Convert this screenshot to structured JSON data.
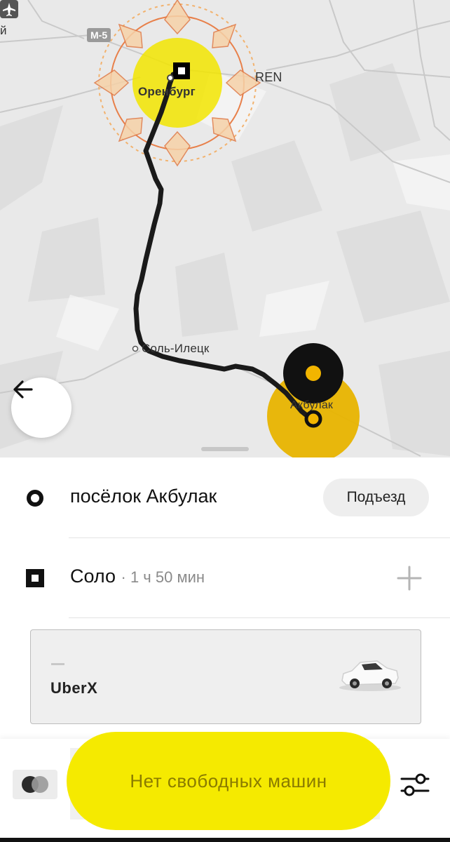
{
  "map": {
    "road_badge": "M-5",
    "edge_label": "й",
    "airport_code": "REN",
    "city_origin": "Оренбург",
    "town_via": "Соль-Илецк",
    "town_destination": "Акбулак",
    "route_color": "#1a1a1a",
    "highlight_color": "#f5e600",
    "destination_glow_color": "#e8b400"
  },
  "trip": {
    "pickup": "посёлок Акбулак",
    "pickup_action": "Подъезд",
    "destination": "Соло",
    "eta": "· 1 ч 50 мин"
  },
  "tariff": {
    "price_placeholder": "—",
    "name": "UberX"
  },
  "footer": {
    "order_label": "Нет свободных машин"
  },
  "icons": {
    "back": "arrow-left-icon",
    "pickup": "ring-marker-icon",
    "destination": "square-marker-icon",
    "add_stop": "plus-icon",
    "payment": "mastercard-icon",
    "filters": "sliders-icon",
    "airport": "airplane-icon",
    "car": "car-icon"
  }
}
